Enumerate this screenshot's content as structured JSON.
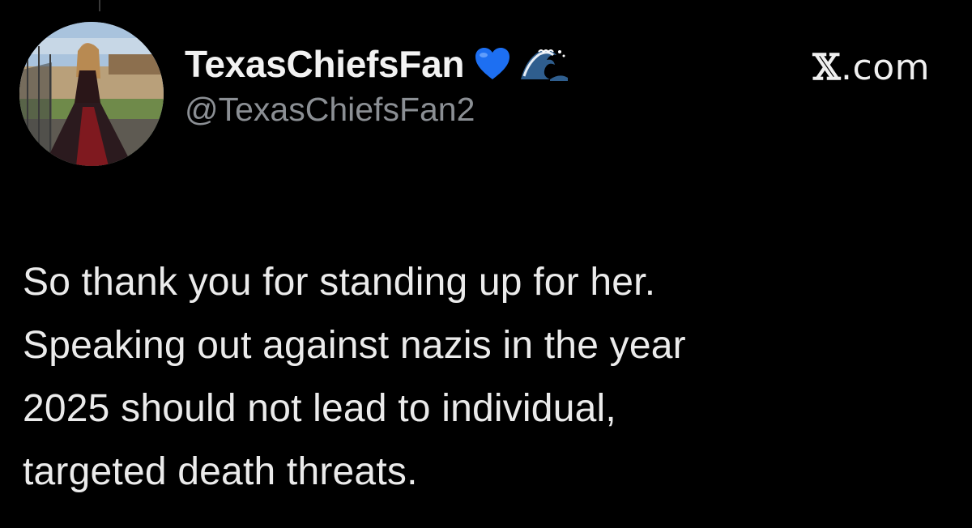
{
  "tweet": {
    "author": {
      "display_name": "TexasChiefsFan",
      "handle": "@TexasChiefsFan2",
      "badges": [
        "blue-heart-icon",
        "wave-icon"
      ]
    },
    "site": {
      "label": ".com",
      "x_glyph": "𝕏"
    },
    "body_lines": [
      "So thank you for standing up for her.",
      "Speaking out against nazis in the year",
      "2025 should not lead to individual,",
      "targeted death threats."
    ]
  },
  "colors": {
    "background": "#000000",
    "text": "#e7e9ea",
    "handle": "#8b8f94",
    "heart": "#1d6ff2"
  }
}
